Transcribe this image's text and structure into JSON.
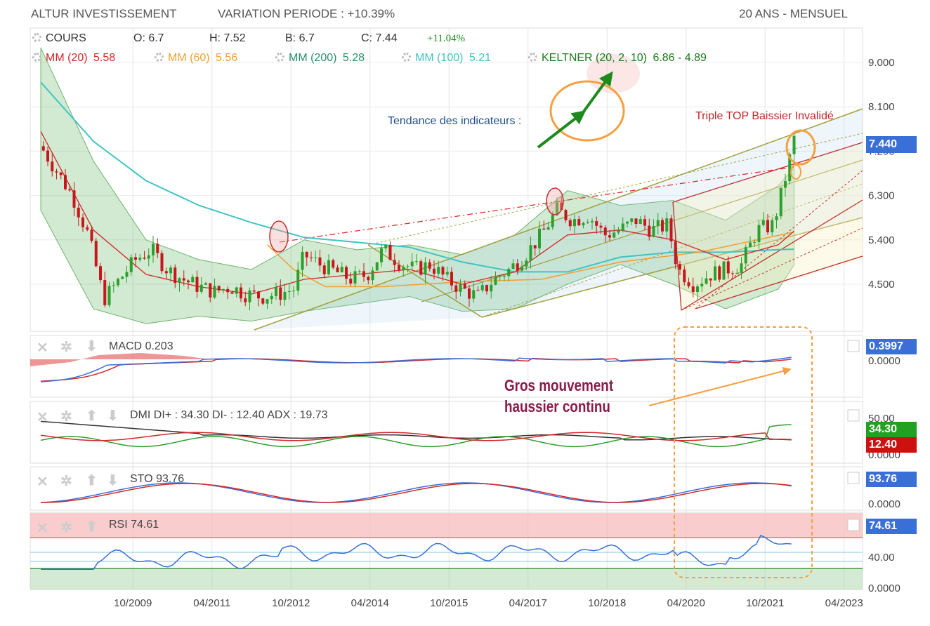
{
  "header": {
    "title": "ALTUR INVESTISSEMENT",
    "variation": "VARIATION PERIODE : +10.39%",
    "period": "20 ANS - MENSUEL"
  },
  "legend": {
    "cours": "COURS",
    "open": "O: 6.7",
    "high": "H: 7.52",
    "low": "B: 6.7",
    "close": "C: 7.44",
    "change": "+11.04%",
    "ma20": "MM (20)",
    "ma20_val": "5.58",
    "ma60": "MM (60)",
    "ma60_val": "5.56",
    "ma200": "MM (200)",
    "ma200_val": "5.28",
    "ma100": "MM (100)",
    "ma100_val": "5.21",
    "keltner": "KELTNER (20, 2, 10)",
    "keltner_val": "6.86 - 4.89"
  },
  "annotations": {
    "trend": "Tendance des indicateurs :",
    "triple_top": "Triple TOP Baissier Invalidé",
    "big_move_line1": "Gros mouvement",
    "big_move_line2": "haussier continu"
  },
  "panels": {
    "macd": {
      "label": "MACD",
      "value": "0.203",
      "badge": "0.3997"
    },
    "dmi": {
      "label": "DMI",
      "value": "DI+ : 34.30 DI- : 12.40 ADX : 19.73",
      "badge_plus": "34.30",
      "badge_minus": "12.40"
    },
    "sto": {
      "label": "STO",
      "value": "93.76",
      "badge": "93.76"
    },
    "rsi": {
      "label": "RSI",
      "value": "74.61",
      "badge": "74.61"
    }
  },
  "colors": {
    "up": "#2ca02c",
    "down": "#c8171c",
    "ma20": "#d62728",
    "ma60": "#f0a030",
    "ma200": "#2a8f6a",
    "ma100": "#40c4c4",
    "keltner": "#1a7a1a",
    "badge_blue": "#3a6fd8",
    "badge_green": "#22a022",
    "badge_red": "#cc1111",
    "annotation": "#8b1a4a",
    "orange": "#f5a040"
  },
  "chart_data": {
    "type": "line",
    "title": "ALTUR INVESTISSEMENT",
    "price_axis": {
      "ticks": [
        "9.000",
        "8.100",
        "7.200",
        "6.300",
        "5.400",
        "4.500"
      ],
      "last_price": "7.440",
      "ylim": [
        3.6,
        9.6
      ]
    },
    "x_ticks": [
      "10/2009",
      "04/2011",
      "10/2012",
      "04/2014",
      "10/2015",
      "04/2017",
      "10/2018",
      "04/2020",
      "10/2021",
      "04/2023"
    ],
    "close": [
      [
        2008.0,
        7.3
      ],
      [
        2008.3,
        6.8
      ],
      [
        2008.6,
        6.3
      ],
      [
        2008.9,
        5.5
      ],
      [
        2009.2,
        4.2
      ],
      [
        2009.5,
        4.6
      ],
      [
        2009.8,
        5.0
      ],
      [
        2010.1,
        5.2
      ],
      [
        2010.4,
        4.8
      ],
      [
        2010.7,
        4.6
      ],
      [
        2011.0,
        4.45
      ],
      [
        2011.3,
        4.35
      ],
      [
        2011.6,
        4.45
      ],
      [
        2011.9,
        4.3
      ],
      [
        2012.2,
        4.25
      ],
      [
        2012.5,
        4.3
      ],
      [
        2012.8,
        4.4
      ],
      [
        2013.0,
        5.1
      ],
      [
        2013.3,
        4.9
      ],
      [
        2013.6,
        4.75
      ],
      [
        2013.9,
        4.6
      ],
      [
        2014.2,
        4.7
      ],
      [
        2014.5,
        5.2
      ],
      [
        2014.8,
        4.95
      ],
      [
        2015.1,
        4.8
      ],
      [
        2015.4,
        4.9
      ],
      [
        2015.7,
        4.6
      ],
      [
        2016.0,
        4.4
      ],
      [
        2016.3,
        4.25
      ],
      [
        2016.6,
        4.6
      ],
      [
        2016.9,
        4.8
      ],
      [
        2017.2,
        5.1
      ],
      [
        2017.5,
        5.5
      ],
      [
        2017.8,
        6.0
      ],
      [
        2018.1,
        5.8
      ],
      [
        2018.4,
        5.9
      ],
      [
        2018.7,
        5.5
      ],
      [
        2019.0,
        5.6
      ],
      [
        2019.3,
        5.8
      ],
      [
        2019.6,
        5.6
      ],
      [
        2019.9,
        5.7
      ],
      [
        2020.1,
        4.8
      ],
      [
        2020.4,
        4.5
      ],
      [
        2020.7,
        4.7
      ],
      [
        2021.0,
        4.8
      ],
      [
        2021.3,
        4.9
      ],
      [
        2021.6,
        5.6
      ],
      [
        2021.9,
        5.7
      ],
      [
        2022.1,
        6.5
      ],
      [
        2022.3,
        7.44
      ]
    ],
    "ma100": [
      [
        2008.0,
        8.6
      ],
      [
        2009.0,
        7.4
      ],
      [
        2010.0,
        6.6
      ],
      [
        2011.0,
        6.1
      ],
      [
        2012.0,
        5.75
      ],
      [
        2013.0,
        5.45
      ],
      [
        2014.0,
        5.35
      ],
      [
        2015.0,
        5.25
      ],
      [
        2016.0,
        4.95
      ],
      [
        2017.0,
        4.75
      ],
      [
        2018.0,
        4.75
      ],
      [
        2019.0,
        5.05
      ],
      [
        2020.0,
        5.15
      ],
      [
        2021.0,
        5.15
      ],
      [
        2022.0,
        5.2
      ],
      [
        2022.3,
        5.21
      ]
    ],
    "ma60": [
      [
        2012.3,
        5.3
      ],
      [
        2012.8,
        4.8
      ],
      [
        2013.4,
        4.45
      ],
      [
        2014.5,
        4.45
      ],
      [
        2016.0,
        4.55
      ],
      [
        2017.5,
        4.6
      ],
      [
        2019.0,
        4.95
      ],
      [
        2020.5,
        5.15
      ],
      [
        2022.3,
        5.56
      ]
    ],
    "ma20": [
      [
        2008.0,
        7.6
      ],
      [
        2009.0,
        5.6
      ],
      [
        2010.0,
        4.7
      ],
      [
        2011.0,
        4.45
      ],
      [
        2012.0,
        4.3
      ],
      [
        2013.0,
        4.6
      ],
      [
        2014.0,
        4.7
      ],
      [
        2015.0,
        4.8
      ],
      [
        2016.0,
        4.5
      ],
      [
        2017.0,
        4.75
      ],
      [
        2018.0,
        5.5
      ],
      [
        2019.0,
        5.6
      ],
      [
        2020.0,
        5.4
      ],
      [
        2021.0,
        5.0
      ],
      [
        2022.0,
        5.3
      ],
      [
        2022.3,
        5.58
      ]
    ],
    "keltner_upper": [
      [
        2008.0,
        9.3
      ],
      [
        2009.0,
        7.0
      ],
      [
        2010.0,
        5.4
      ],
      [
        2011.0,
        5.0
      ],
      [
        2012.0,
        4.8
      ],
      [
        2013.0,
        5.4
      ],
      [
        2014.0,
        5.2
      ],
      [
        2015.0,
        5.3
      ],
      [
        2016.0,
        5.1
      ],
      [
        2017.0,
        5.5
      ],
      [
        2018.0,
        6.4
      ],
      [
        2019.0,
        6.1
      ],
      [
        2020.0,
        6.2
      ],
      [
        2021.0,
        5.8
      ],
      [
        2022.0,
        6.5
      ],
      [
        2022.3,
        6.86
      ]
    ],
    "keltner_lower": [
      [
        2008.0,
        6.0
      ],
      [
        2009.0,
        4.0
      ],
      [
        2010.0,
        3.7
      ],
      [
        2011.0,
        3.85
      ],
      [
        2012.0,
        3.75
      ],
      [
        2013.0,
        3.95
      ],
      [
        2014.0,
        4.1
      ],
      [
        2015.0,
        4.25
      ],
      [
        2016.0,
        3.95
      ],
      [
        2017.0,
        4.0
      ],
      [
        2018.0,
        4.5
      ],
      [
        2019.0,
        4.9
      ],
      [
        2020.0,
        4.5
      ],
      [
        2021.0,
        4.0
      ],
      [
        2022.0,
        4.4
      ],
      [
        2022.3,
        4.89
      ]
    ],
    "indicators": {
      "macd": {
        "last": 0.3997,
        "value": 0.203
      },
      "dmi": {
        "di_plus": 34.3,
        "di_minus": 12.4,
        "adx": 19.73
      },
      "sto": {
        "last": 93.76
      },
      "rsi": {
        "last": 74.61,
        "axis_ticks": [
          "40.00",
          "0.0000"
        ]
      }
    },
    "indicator_axis_ticks": {
      "macd": "0.0000",
      "dmi": [
        "50.00",
        "0.0000"
      ],
      "sto": "0.0000",
      "rsi": [
        "40.00",
        "0.0000"
      ]
    }
  }
}
